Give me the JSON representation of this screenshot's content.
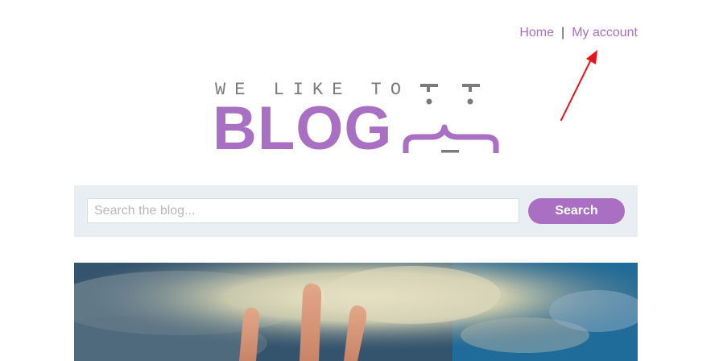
{
  "nav": {
    "home": "Home",
    "separator": "|",
    "account": "My account"
  },
  "logo": {
    "tagline": "WE LIKE TO",
    "word": "BLOG"
  },
  "search": {
    "placeholder": "Search the blog...",
    "button": "Search"
  },
  "colors": {
    "accent": "#a96fc3",
    "annotation_arrow": "#e8141b",
    "search_panel": "#e8eef1"
  },
  "hero": {
    "icon": "hand-in-sky-photo"
  }
}
